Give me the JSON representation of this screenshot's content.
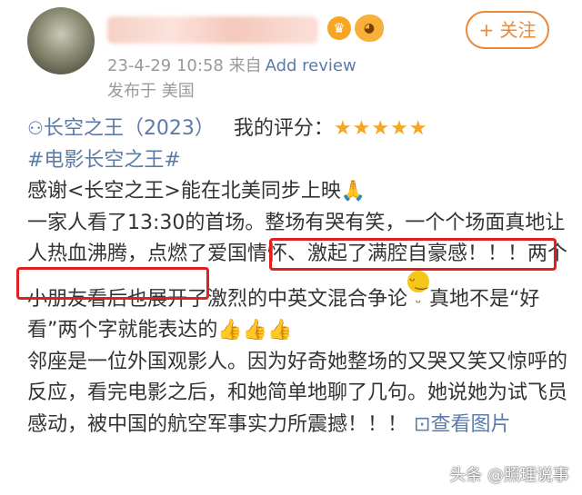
{
  "header": {
    "follow_label": "+ 关注",
    "timestamp": "23-4-29 10:58",
    "source_prefix": "来自",
    "source_app": "Add review",
    "location": "发布于 美国",
    "vip_icon": "crown-icon",
    "badge_icon": "fish-icon"
  },
  "post": {
    "movie_title": "长空之王（2023）",
    "rating_label": "我的评分：",
    "rating_stars": 5,
    "stars_text": "★★★★★",
    "hashtag": "#电影长空之王#",
    "line1": "感谢<长空之王>能在北美同步上映",
    "hands_emoji": "🙏",
    "p1_a": "一家人看了13:30的首场。整场有哭有笑，一个个场面真地让人热血沸腾，",
    "p1_highlight": "点燃了爱国情怀、激起了满腔自豪感！！！",
    "p1_b": "两个小朋友看后也展开了激烈的中英文混合争论",
    "laugh_emoji": "😄",
    "p1_c": "真地不是“好看”两个字就能表达的",
    "thumbs": "👍👍👍",
    "p2": "邻座是一位外国观影人。因为好奇她整场的又哭又笑又惊呼的反应，看完电影之后，和她简单地聊了几句。她说她为试飞员感动，被中国的航空军事实力所震撼！！！",
    "view_images": "查看图片"
  },
  "watermark": "头条 @照理说事",
  "colors": {
    "accent": "#e8893b",
    "link": "#5b7ba8",
    "highlight_box": "#e02020",
    "star": "#f5a623"
  }
}
